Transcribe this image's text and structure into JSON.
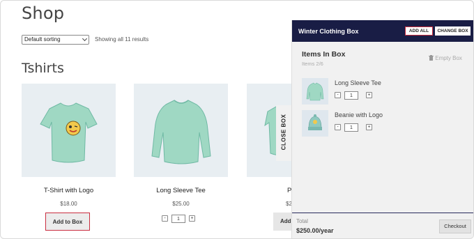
{
  "shop": {
    "title": "Shop",
    "sort_selected": "Default sorting",
    "results_text": "Showing all 11 results",
    "category_title": "Tshirts"
  },
  "products": [
    {
      "name": "T-Shirt with Logo",
      "price": "$18.00",
      "add_label": "Add to Box"
    },
    {
      "name": "Long Sleeve Tee",
      "price": "$25.00",
      "qty": "1"
    },
    {
      "name": "P",
      "price": "$2",
      "add_label": "Add"
    }
  ],
  "box": {
    "title": "Winter Clothing Box",
    "add_all_label": "ADD ALL",
    "change_box_label": "CHANGE BOX",
    "items_title": "Items In Box",
    "items_count": "Items 2/6",
    "empty_label": "Empty Box",
    "close_label": "CLOSE BOX",
    "items": [
      {
        "name": "Long Sleeve Tee",
        "qty": "1"
      },
      {
        "name": "Beanie with Logo",
        "qty": "1"
      }
    ],
    "total_label": "Total",
    "total_value": "$250.00/year",
    "checkout_label": "Checkout"
  },
  "colors": {
    "header_bg": "#191d45",
    "highlight_border": "#c92d3f",
    "product_bg": "#e8eef2",
    "shirt_green": "#9fd8c3"
  }
}
